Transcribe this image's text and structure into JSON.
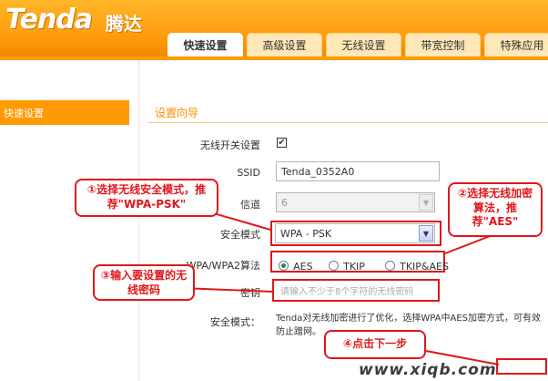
{
  "header": {
    "logo_text": "Tenda",
    "logo_cn": "腾达",
    "tabs": [
      {
        "label": "快速设置",
        "active": true
      },
      {
        "label": "高级设置",
        "active": false
      },
      {
        "label": "无线设置",
        "active": false
      },
      {
        "label": "带宽控制",
        "active": false
      },
      {
        "label": "特殊应用",
        "active": false
      }
    ]
  },
  "sidebar": {
    "items": [
      {
        "label": "快速设置",
        "active": true
      }
    ]
  },
  "main": {
    "section_title": "设置向导",
    "wireless_switch": {
      "label": "无线开关设置",
      "checked": true
    },
    "ssid": {
      "label": "SSID",
      "value": "Tenda_0352A0"
    },
    "channel": {
      "label": "信道",
      "value": "6"
    },
    "security_mode": {
      "label": "安全模式",
      "value": "WPA - PSK"
    },
    "algorithm": {
      "label": "WPA/WPA2算法",
      "options": [
        {
          "label": "AES",
          "selected": true
        },
        {
          "label": "TKIP",
          "selected": false
        },
        {
          "label": "TKIP&AES",
          "selected": false
        }
      ]
    },
    "key": {
      "label": "密钥",
      "placeholder": "请输入不少于8个字符的无线密码"
    },
    "note": {
      "label": "安全模式：",
      "text": "Tenda对无线加密进行了优化，选择WPA中AES加密方式，可有效防止蹭网。"
    }
  },
  "annotations": {
    "callout1": "①选择无线安全模式，推荐\"WPA-PSK\"",
    "callout2": "②选择无线加密算法，推荐\"AES\"",
    "callout3": "③输入要设置的无线密码",
    "callout4": "④点击下一步",
    "watermark": "www.xiqb.com"
  },
  "colors": {
    "accent_orange": "#ff9b00",
    "callout_red": "#e0171b",
    "section_title": "#ff8c00"
  }
}
